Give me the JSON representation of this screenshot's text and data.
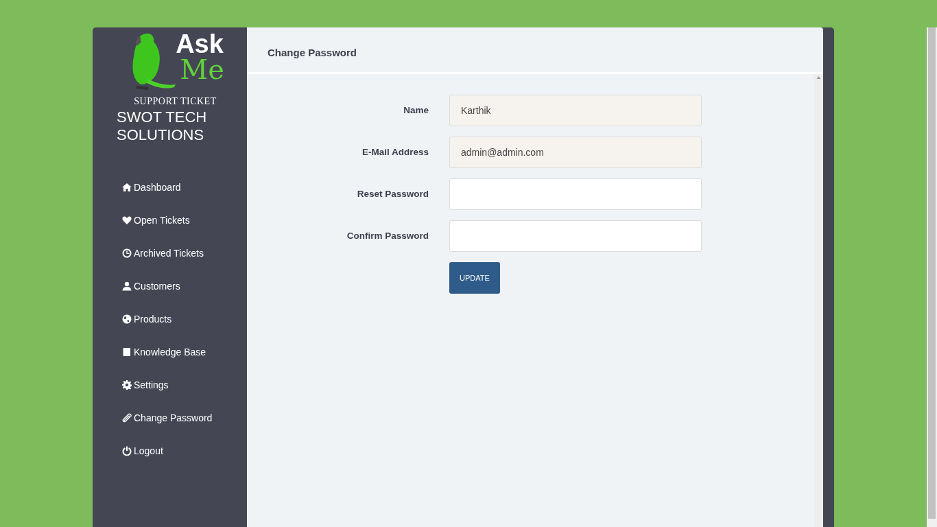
{
  "brand": {
    "logo_word_1": "Ask",
    "logo_word_2": "Me",
    "tagline": "SUPPORT TICKET",
    "company": "SWOT TECH SOLUTIONS"
  },
  "sidebar": {
    "items": [
      {
        "label": "Dashboard"
      },
      {
        "label": "Open Tickets"
      },
      {
        "label": "Archived Tickets"
      },
      {
        "label": "Customers"
      },
      {
        "label": "Products"
      },
      {
        "label": "Knowledge Base"
      },
      {
        "label": "Settings"
      },
      {
        "label": "Change Password"
      },
      {
        "label": "Logout"
      }
    ]
  },
  "page": {
    "title": "Change Password"
  },
  "form": {
    "fields": [
      {
        "label": "Name",
        "value": "Karthik",
        "readonly": true
      },
      {
        "label": "E-Mail Address",
        "value": "admin@admin.com",
        "readonly": true
      },
      {
        "label": "Reset Password",
        "readonly": false
      },
      {
        "label": "Confirm Password",
        "readonly": false
      }
    ],
    "submit": "UPDATE"
  }
}
